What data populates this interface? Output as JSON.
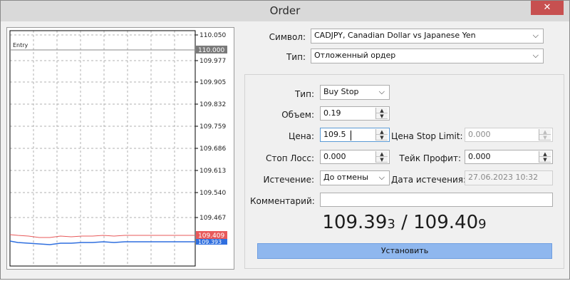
{
  "window": {
    "title": "Order",
    "close_label": "✕"
  },
  "chart": {
    "entry_label": "Entry",
    "price_labels": [
      "110.050",
      "109.977",
      "109.905",
      "109.832",
      "109.759",
      "109.686",
      "109.613",
      "109.540",
      "109.467"
    ],
    "entry_price_tag": "110.000",
    "ask_tag": "109.409",
    "bid_tag": "109.393",
    "ask_color": "#e8595a",
    "bid_color": "#2f6fdf"
  },
  "form": {
    "symbol_label": "Символ:",
    "symbol_value": "CADJPY, Canadian Dollar vs Japanese Yen",
    "type_label": "Тип:",
    "type_value": "Отложенный ордер",
    "order_type_label": "Тип:",
    "order_type_value": "Buy Stop",
    "volume_label": "Объем:",
    "volume_value": "0.19",
    "price_label": "Цена:",
    "price_value": "109.5",
    "stop_limit_label": "Цена Stop Limit:",
    "stop_limit_value": "0.000",
    "stop_loss_label": "Стоп Лосс:",
    "stop_loss_value": "0.000",
    "take_profit_label": "Тейк Профит:",
    "take_profit_value": "0.000",
    "expiry_label": "Истечение:",
    "expiry_value": "До отмены",
    "expiry_date_label": "Дата истечения:",
    "expiry_date_value": "27.06.2023 10:32",
    "comment_label": "Комментарий:",
    "comment_value": ""
  },
  "quote": {
    "bid_main": "109.39",
    "bid_small": "3",
    "separator": " / ",
    "ask_main": "109.40",
    "ask_small": "9"
  },
  "submit_label": "Установить"
}
